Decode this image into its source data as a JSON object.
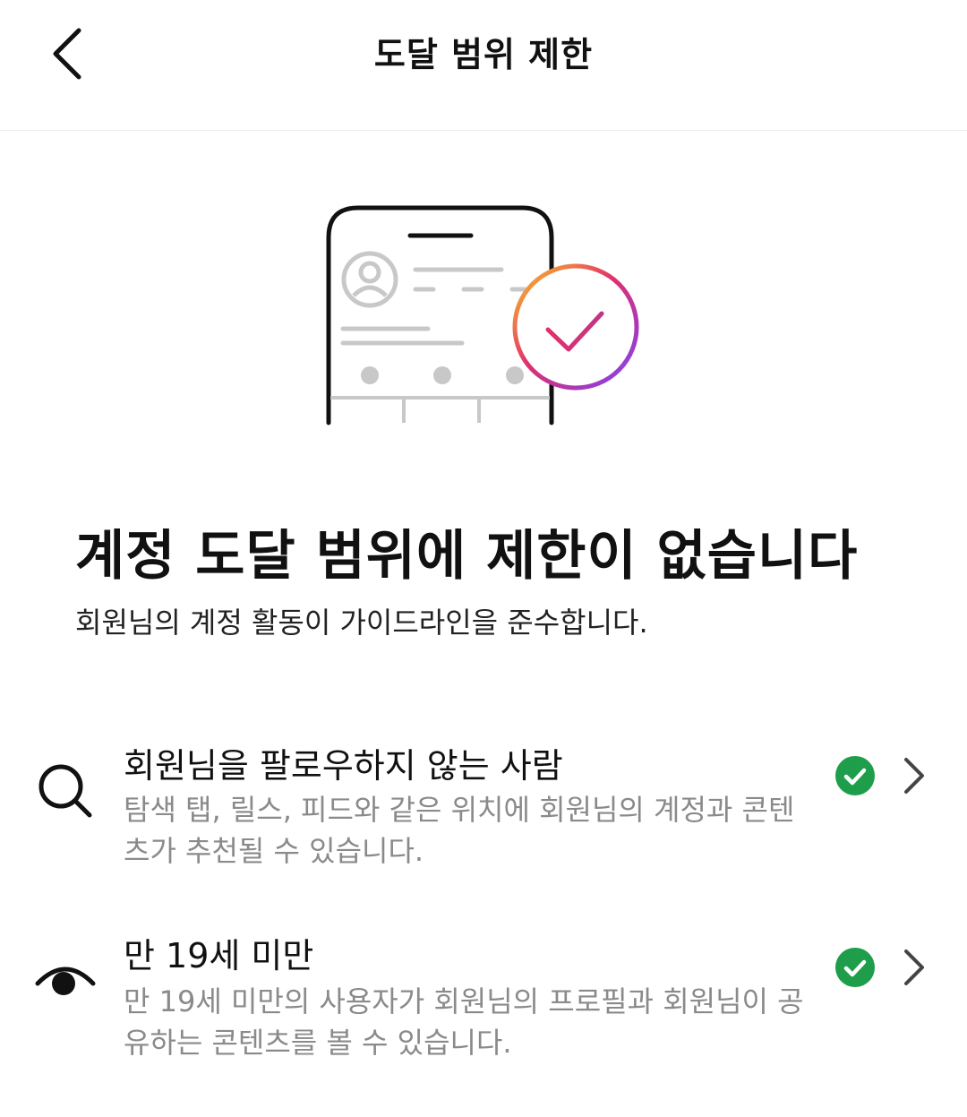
{
  "header": {
    "title": "도달 범위 제한",
    "back_icon": "chevron-left-icon"
  },
  "hero": {
    "illustration_icon": "phone-profile-check-illustration",
    "gradient_colors": [
      "#F9C623",
      "#E1306C",
      "#8A3AB9",
      "#7C4DFF"
    ]
  },
  "main": {
    "title": "계정 도달 범위에 제한이 없습니다",
    "subtitle": "회원님의 계정 활동이 가이드라인을 준수합니다."
  },
  "items": [
    {
      "icon": "search-icon",
      "title": "회원님을 팔로우하지 않는 사람",
      "description": "탐색 탭, 릴스, 피드와 같은 위치에 회원님의 계정과 콘텐츠가 추천될 수 있습니다.",
      "status_icon": "check-circle-icon",
      "status_color": "#1E9E4A",
      "chevron_icon": "chevron-right-icon"
    },
    {
      "icon": "eye-icon",
      "title": "만 19세 미만",
      "description": "만 19세 미만의 사용자가 회원님의 프로필과 회원님이 공유하는 콘텐츠를 볼 수 있습니다.",
      "status_icon": "check-circle-icon",
      "status_color": "#1E9E4A",
      "chevron_icon": "chevron-right-icon"
    }
  ]
}
